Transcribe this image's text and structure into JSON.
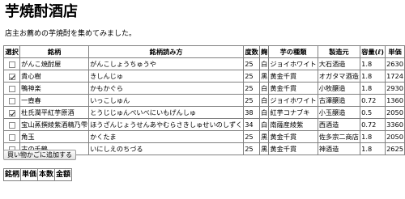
{
  "page": {
    "title": "芋焼酎酒店",
    "intro": "店主お薦めの芋焼酎を集めてみました。"
  },
  "table": {
    "headers": [
      "選択",
      "銘柄",
      "銘柄読み方",
      "度数",
      "麹",
      "芋の種類",
      "製造元",
      "容量(ℓ)",
      "単価"
    ],
    "rows": [
      {
        "checked": false,
        "name": "がんこ焼酎屋",
        "reading": "がんこしょうちゅうや",
        "abv": "25",
        "koji": "白",
        "imo": "ジョイホワイト",
        "maker": "大石酒造",
        "vol": "1.8",
        "price": "2630"
      },
      {
        "checked": true,
        "name": "貴心樹",
        "reading": "きしんじゅ",
        "abv": "25",
        "koji": "黒",
        "imo": "黄金千貫",
        "maker": "オガタマ酒造",
        "vol": "1.8",
        "price": "1724"
      },
      {
        "checked": false,
        "name": "鴨神楽",
        "reading": "かもかぐら",
        "abv": "25",
        "koji": "白",
        "imo": "黄金千貫",
        "maker": "小牧醸造",
        "vol": "1.8",
        "price": "2930"
      },
      {
        "checked": false,
        "name": "一壺春",
        "reading": "いっこしゅん",
        "abv": "25",
        "koji": "白",
        "imo": "ジョイホワイト",
        "maker": "古澤醸造",
        "vol": "0.72",
        "price": "1360"
      },
      {
        "checked": true,
        "name": "杜氏潤平紅芋原酒",
        "reading": "とうじじゅんぺいべにいもげんしゅ",
        "abv": "38",
        "koji": "白",
        "imo": "紅芋コナブキ",
        "maker": "小玉醸造",
        "vol": "0.5",
        "price": "2050"
      },
      {
        "checked": false,
        "name": "宝山蒸撰綾紫酒精乃雫",
        "reading": "ほうざんじょうせんあやむらさきしゅせいのしずく",
        "abv": "34",
        "koji": "白",
        "imo": "南薩産綾紫",
        "maker": "西酒造",
        "vol": "0.72",
        "price": "3360"
      },
      {
        "checked": false,
        "name": "角玉",
        "reading": "かくたま",
        "abv": "25",
        "koji": "黒",
        "imo": "黄金千貫",
        "maker": "佐多宗二商店",
        "vol": "1.8",
        "price": "2050"
      },
      {
        "checked": false,
        "name": "古の千鶴",
        "reading": "いにしえのちづる",
        "abv": "25",
        "koji": "黒",
        "imo": "黄金千貫",
        "maker": "神酒造",
        "vol": "1.8",
        "price": "2625"
      }
    ]
  },
  "buttons": {
    "add_to_cart": "買い物かごに追加する"
  },
  "cart": {
    "headers": [
      "銘柄",
      "単価",
      "本数",
      "金額"
    ]
  }
}
